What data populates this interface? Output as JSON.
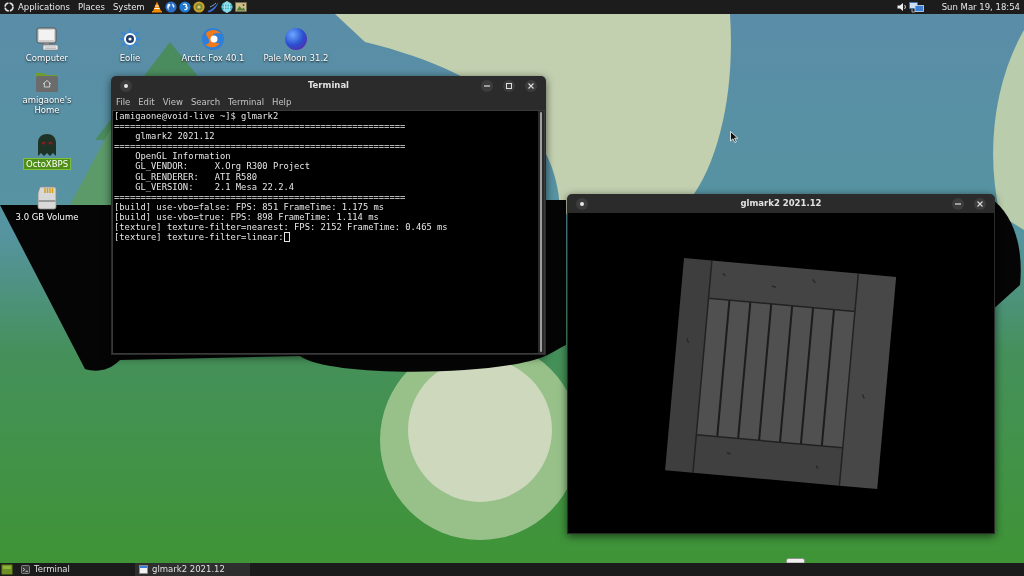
{
  "top_panel": {
    "menus": [
      "Applications",
      "Places",
      "System"
    ],
    "clock": "Sun Mar 19, 18:54"
  },
  "desktop_icons": [
    {
      "label": "Computer",
      "kind": "computer",
      "selected": false
    },
    {
      "label": "Eolie",
      "kind": "star",
      "selected": false
    },
    {
      "label": "Arctic Fox 40.1",
      "kind": "foxglobe",
      "selected": false
    },
    {
      "label": "Pale Moon 31.2",
      "kind": "sphere",
      "selected": false
    },
    {
      "label": "amigaone's Home",
      "kind": "home",
      "selected": false
    },
    {
      "label": "OctoXBPS",
      "kind": "ghost",
      "selected": true
    },
    {
      "label": "3.0 GB Volume",
      "kind": "card",
      "selected": false
    }
  ],
  "terminal_window": {
    "title": "Terminal",
    "menu": [
      "File",
      "Edit",
      "View",
      "Search",
      "Terminal",
      "Help"
    ],
    "lines": [
      "[amigaone@void-live ~]$ glmark2",
      "=======================================================",
      "    glmark2 2021.12",
      "=======================================================",
      "    OpenGL Information",
      "    GL_VENDOR:     X.Org R300 Project",
      "    GL_RENDERER:   ATI R580",
      "    GL_VERSION:    2.1 Mesa 22.2.4",
      "=======================================================",
      "[build] use-vbo=false: FPS: 851 FrameTime: 1.175 ms",
      "[build] use-vbo=true: FPS: 898 FrameTime: 1.114 ms",
      "[texture] texture-filter=nearest: FPS: 2152 FrameTime: 0.465 ms",
      "[texture] texture-filter=linear:"
    ]
  },
  "glmark_window": {
    "title": "glmark2 2021.12"
  },
  "taskbar": {
    "tasks": [
      {
        "label": "Terminal",
        "kind": "terminal",
        "selected": false
      },
      {
        "label": "glmark2 2021.12",
        "kind": "window",
        "selected": true
      }
    ]
  }
}
